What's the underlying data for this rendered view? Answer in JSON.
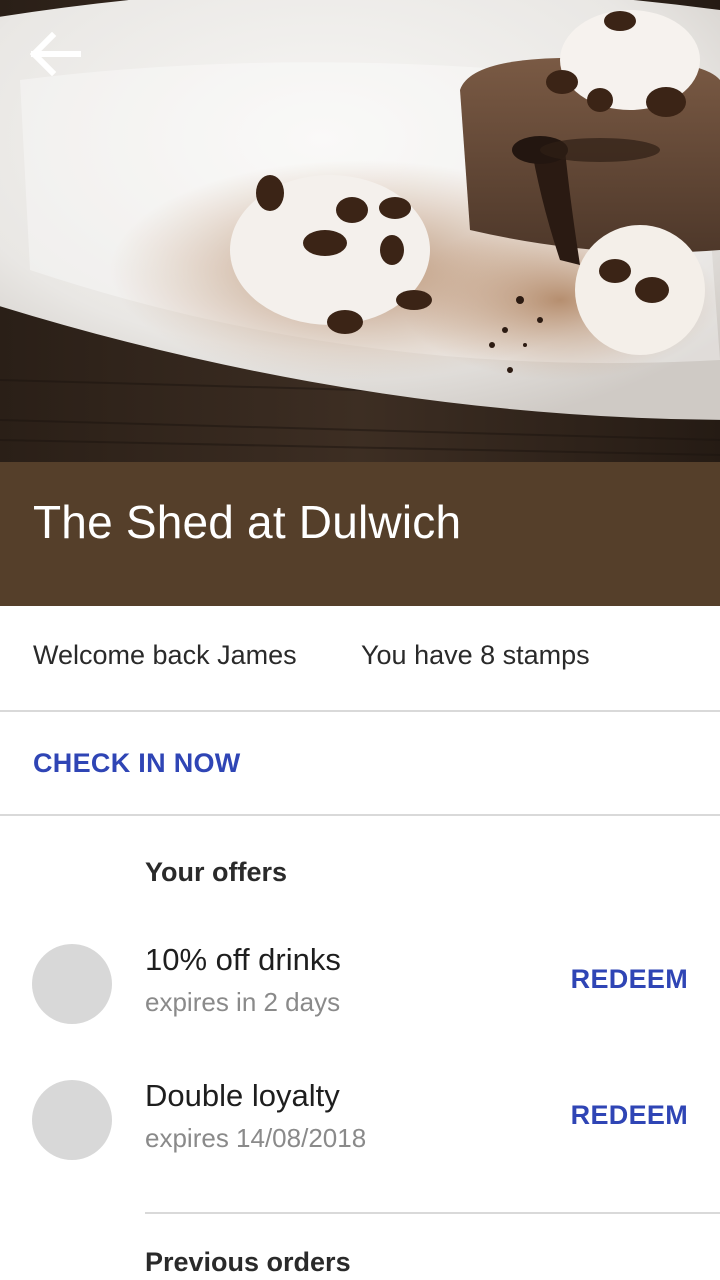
{
  "header": {
    "back_icon": "arrow-back-icon",
    "title": "The Shed at Dulwich",
    "brand_color": "#553f2a"
  },
  "summary": {
    "welcome": "Welcome back James",
    "stamps": "You have 8 stamps"
  },
  "checkin": {
    "label": "CHECK IN NOW",
    "accent_color": "#2f45b5"
  },
  "offers": {
    "title": "Your offers",
    "items": [
      {
        "name": "10% off drinks",
        "expiry": "expires in 2 days",
        "action": "REDEEM"
      },
      {
        "name": "Double loyalty",
        "expiry": "expires 14/08/2018",
        "action": "REDEEM"
      }
    ]
  },
  "previous_orders": {
    "title": "Previous orders"
  }
}
